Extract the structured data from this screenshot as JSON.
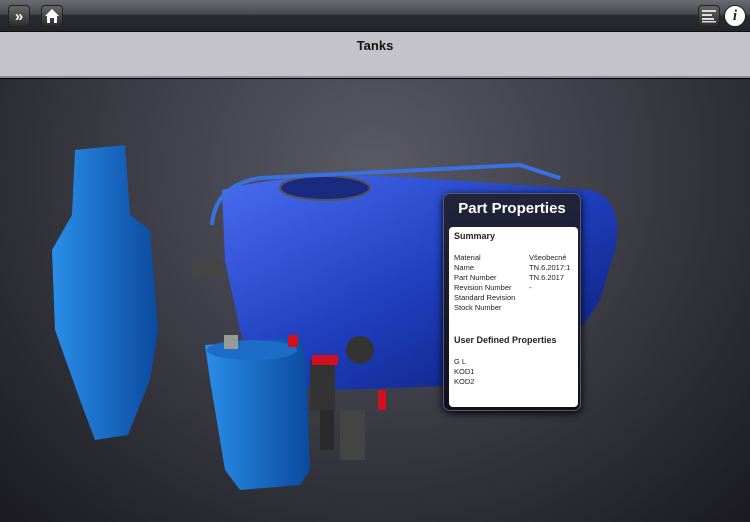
{
  "toolbar": {
    "expand_icon": "double-chevron-right",
    "home_icon": "home",
    "list_icon": "list",
    "info_icon": "info",
    "info_glyph": "i",
    "expand_glyph": "»"
  },
  "header": {
    "title": "Tanks"
  },
  "part_properties": {
    "title": "Part Properties",
    "summary_heading": "Summary",
    "summary": [
      {
        "key": "Material",
        "value": "Všeobecné"
      },
      {
        "key": "Name",
        "value": "TN.6.2017:1"
      },
      {
        "key": "Part Number",
        "value": "TN.6.2017"
      },
      {
        "key": "Revision Number",
        "value": "-"
      },
      {
        "key": "Standard Revision",
        "value": ""
      },
      {
        "key": "Stock Number",
        "value": ""
      }
    ],
    "user_defined_heading": "User Defined Properties",
    "user_defined": [
      {
        "key": "G L"
      },
      {
        "key": "KOD1"
      },
      {
        "key": "KOD2"
      }
    ]
  },
  "colors": {
    "model_blue": "#1f3fbf",
    "accent_red": "#d01020"
  }
}
